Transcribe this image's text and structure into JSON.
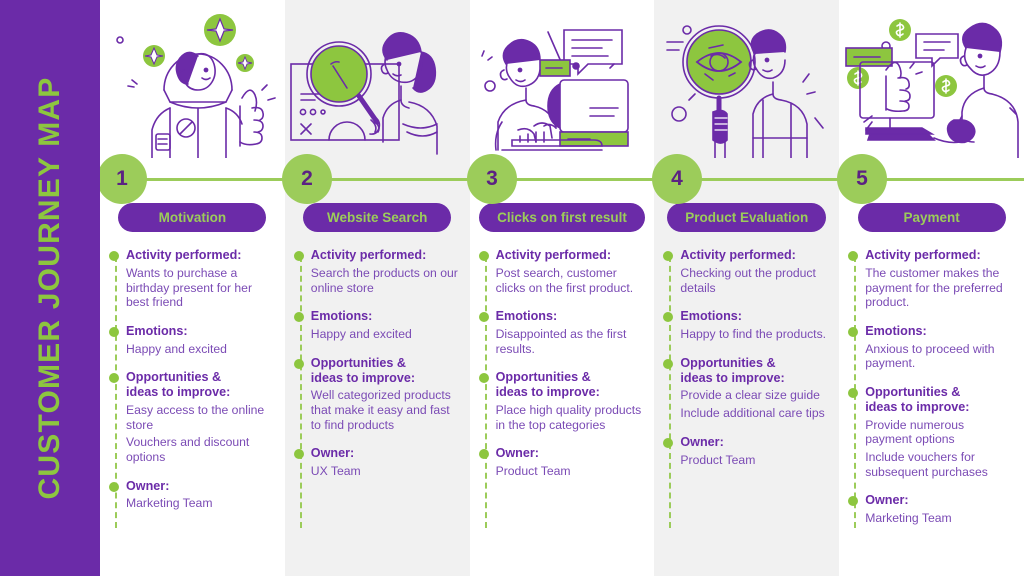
{
  "sidebar": {
    "title": "CUSTOMER JOURNEY MAP"
  },
  "colors": {
    "purple": "#6B2BA8",
    "green": "#8DC63F",
    "light_green": "#9CCC5A",
    "text_purple": "#7B4BB5",
    "alt_column_bg": "#F1F1F1"
  },
  "labels": {
    "activity": "Activity performed:",
    "emotions": "Emotions:",
    "opportunities": "Opportunities &\nideas to improve:",
    "opportunities_line1": "Opportunities &",
    "opportunities_line2": "ideas to improve:",
    "owner": "Owner:"
  },
  "stages": [
    {
      "number": "1",
      "title": "Motivation",
      "illustration": "astronaut-thumbs-up-icon",
      "activity": "Wants to purchase a birthday present for her best friend",
      "emotions": "Happy and excited",
      "opportunities": [
        "Easy access to the online store",
        "Vouchers and discount options"
      ],
      "owner": "Marketing Team"
    },
    {
      "number": "2",
      "title": "Website Search",
      "illustration": "magnifying-glass-search-icon",
      "activity": "Search the products on our online store",
      "emotions": "Happy and excited",
      "opportunities": [
        "Well categorized products that make it easy and fast to find products"
      ],
      "owner": "UX Team"
    },
    {
      "number": "3",
      "title": "Clicks on first result",
      "illustration": "person-at-keyboard-icon",
      "activity": "Post search, customer clicks on the first product.",
      "emotions": "Disappointed as the first results.",
      "opportunities": [
        "Place high quality products in the top categories"
      ],
      "owner": "Product Team"
    },
    {
      "number": "4",
      "title": "Product Evaluation",
      "illustration": "magnifying-glass-eye-icon",
      "activity": "Checking out the product details",
      "emotions": "Happy to find the products.",
      "opportunities": [
        "Provide a clear size guide",
        "Include additional care tips"
      ],
      "owner": "Product Team"
    },
    {
      "number": "5",
      "title": "Payment",
      "illustration": "person-computer-payment-icon",
      "activity": "The customer makes the payment for the preferred product.",
      "emotions": "Anxious to proceed with payment.",
      "opportunities": [
        "Provide numerous payment options",
        "Include vouchers for subsequent purchases"
      ],
      "owner": "Marketing Team"
    }
  ]
}
